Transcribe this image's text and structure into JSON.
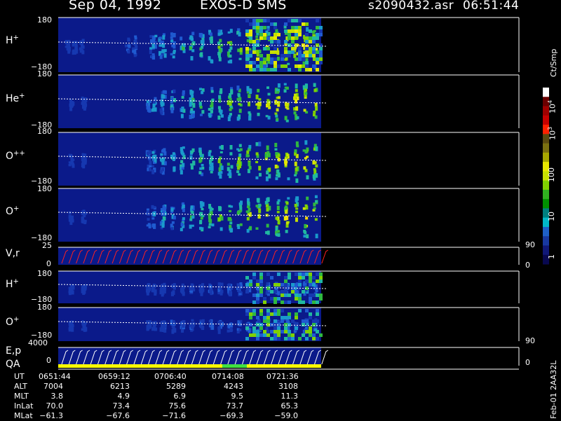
{
  "header": {
    "date": "Sep 04, 1992",
    "instrument": "EXOS-D SMS",
    "file": "s2090432.asr",
    "time": "06:51:44"
  },
  "panels": [
    {
      "label": "H",
      "sup": "+",
      "top": "180",
      "bottom": "−180"
    },
    {
      "label": "He",
      "sup": "+",
      "top": "180",
      "bottom": "−180"
    },
    {
      "label": "O",
      "sup": "++",
      "top": "180",
      "bottom": "−180"
    },
    {
      "label": "O",
      "sup": "+",
      "top": "180",
      "bottom": "−180"
    },
    {
      "label": "V,r",
      "sup": "",
      "top": "25",
      "bottom": "0",
      "right_top": "90",
      "right_bottom": "0"
    },
    {
      "label": "H",
      "sup": "+",
      "top": "180",
      "bottom": "−180"
    },
    {
      "label": "O",
      "sup": "+",
      "top": "180",
      "bottom": "−180"
    },
    {
      "label": "E,p",
      "label2": "QA",
      "sup": "",
      "top": "4000",
      "bottom": "0",
      "right_top": "90",
      "right_bottom": "0"
    }
  ],
  "colorbar": {
    "unit": "Ct/Smp",
    "labels": [
      {
        "base": "10",
        "exp": "4"
      },
      {
        "base": "10",
        "exp": "3"
      },
      {
        "base": "100",
        "exp": ""
      },
      {
        "base": "10",
        "exp": ""
      },
      {
        "base": "1",
        "exp": ""
      }
    ],
    "colors": [
      "#ffffff",
      "#6b0000",
      "#a00000",
      "#c80000",
      "#ff2000",
      "#5a4a10",
      "#7a7010",
      "#a8a800",
      "#e8e800",
      "#c8e000",
      "#80d000",
      "#30b020",
      "#009000",
      "#008080",
      "#00b8c8",
      "#1e60c8",
      "#1838a0",
      "#101878",
      "#080850"
    ]
  },
  "footer": {
    "row_labels": [
      "UT",
      "ALT",
      "MLT",
      "InLat",
      "MLat"
    ],
    "columns": [
      [
        "0651:44",
        "7004",
        "3.8",
        "70.0",
        "−61.3"
      ],
      [
        "0659:12",
        "6213",
        "4.9",
        "73.4",
        "−67.6"
      ],
      [
        "0706:40",
        "5289",
        "6.9",
        "75.6",
        "−71.6"
      ],
      [
        "0714:08",
        "4243",
        "9.5",
        "73.7",
        "−69.3"
      ],
      [
        "0721:36",
        "3108",
        "11.3",
        "65.3",
        "−59.0"
      ]
    ],
    "stamp": "Feb-01 2AA32L"
  }
}
